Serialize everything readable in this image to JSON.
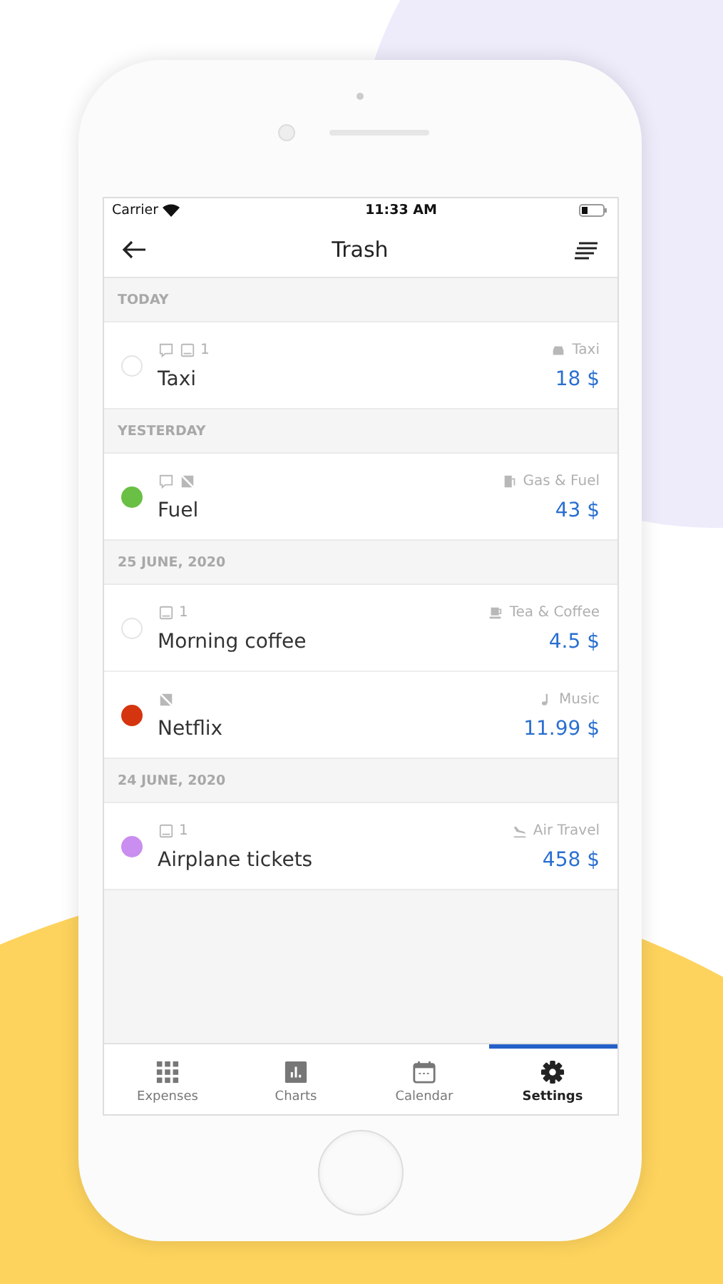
{
  "status_bar": {
    "carrier": "Carrier",
    "time": "11:33 AM"
  },
  "nav_bar": {
    "title": "Trash"
  },
  "sections": [
    {
      "header": "TODAY",
      "entries": [
        {
          "name": "Taxi",
          "amount": "18 $",
          "category": {
            "kind": "car",
            "label": "Taxi"
          },
          "meta": [
            {
              "kind": "comment"
            },
            {
              "kind": "photo",
              "count": "1"
            }
          ]
        }
      ]
    },
    {
      "header": "YESTERDAY",
      "entries": [
        {
          "name": "Fuel",
          "amount": "43 $",
          "category": {
            "kind": "fuel",
            "label": "Gas & Fuel"
          },
          "color": "#6abf45",
          "meta": [
            {
              "kind": "comment"
            },
            {
              "kind": "no-photo"
            }
          ]
        }
      ]
    },
    {
      "header": "25 JUNE, 2020",
      "entries": [
        {
          "name": "Morning coffee",
          "amount": "4.5 $",
          "category": {
            "kind": "cup",
            "label": "Tea & Coffee"
          },
          "meta": [
            {
              "kind": "photo",
              "count": "1"
            }
          ]
        },
        {
          "name": "Netflix",
          "amount": "11.99 $",
          "category": {
            "kind": "music",
            "label": "Music"
          },
          "color": "#d4350f",
          "meta": [
            {
              "kind": "no-photo"
            }
          ]
        }
      ]
    },
    {
      "header": "24 JUNE, 2020",
      "entries": [
        {
          "name": "Airplane tickets",
          "amount": "458 $",
          "category": {
            "kind": "plane",
            "label": "Air Travel"
          },
          "color": "#c98ef0",
          "meta": [
            {
              "kind": "photo",
              "count": "1"
            }
          ]
        }
      ]
    }
  ],
  "tab_bar": [
    {
      "label": "Expenses",
      "selected": false
    },
    {
      "label": "Charts",
      "selected": false
    },
    {
      "label": "Calendar",
      "selected": false
    },
    {
      "label": "Settings",
      "selected": true
    }
  ]
}
